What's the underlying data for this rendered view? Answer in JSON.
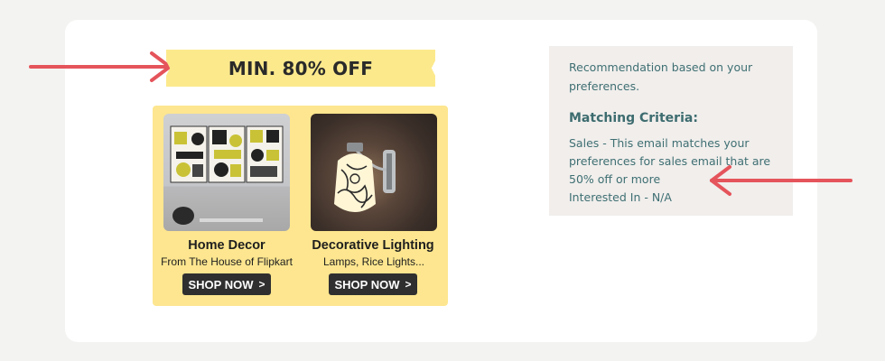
{
  "banner": {
    "text": "MIN. 80% OFF"
  },
  "products": [
    {
      "title": "Home Decor",
      "subtitle": "From The House of Flipkart",
      "button": "SHOP NOW",
      "button_icon": "chevron-right-icon"
    },
    {
      "title": "Decorative Lighting",
      "subtitle": "Lamps, Rice Lights...",
      "button": "SHOP NOW",
      "button_icon": "chevron-right-icon"
    }
  ],
  "info": {
    "intro": "Recommendation based on your preferences.",
    "criteria_heading": "Matching Criteria:",
    "sales_line": "Sales - This email matches your preferences for sales email that are 50% off or more",
    "interested_line": "Interested In - N/A"
  },
  "colors": {
    "page_bg": "#f3f3f1",
    "card_bg": "#ffffff",
    "banner_bg": "#fce98c",
    "promo_bg": "#fde68f",
    "button_bg": "#2f2f2f",
    "info_bg": "#f1eeec",
    "info_text": "#3f6f72",
    "arrow": "#e5545b"
  }
}
